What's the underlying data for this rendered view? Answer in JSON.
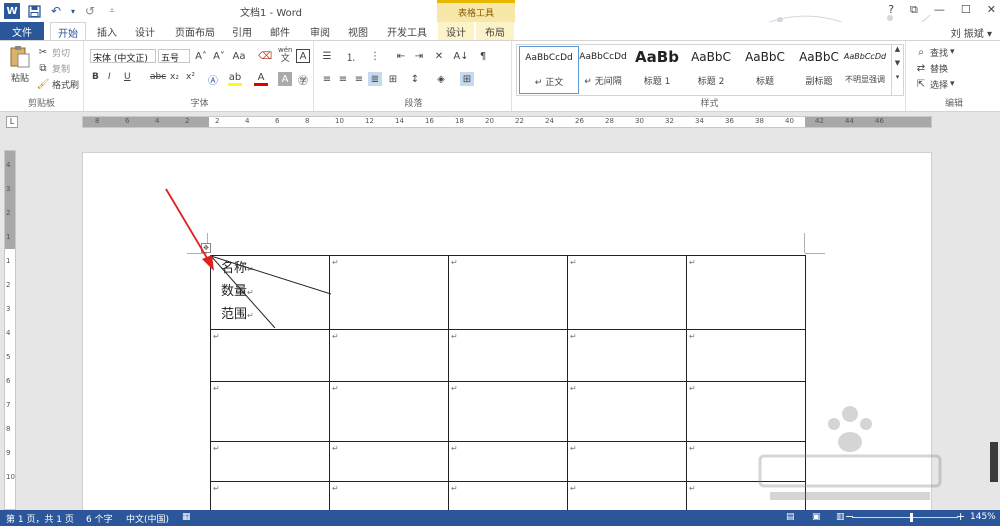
{
  "titlebar": {
    "app_icon": "W",
    "title": "文档1 - Word",
    "table_tools": "表格工具",
    "controls": [
      "?",
      "⧉",
      "—",
      "☐",
      "✕"
    ]
  },
  "tabs": {
    "file": "文件",
    "items": [
      "开始",
      "插入",
      "设计",
      "页面布局",
      "引用",
      "邮件",
      "审阅",
      "视图",
      "开发工具",
      "设计",
      "布局"
    ],
    "user": "刘 振斌 ▾"
  },
  "clipboard": {
    "paste": "粘贴",
    "cut": "剪切",
    "copy": "复制",
    "format_painter": "格式刷",
    "label": "剪贴板"
  },
  "font": {
    "font_name": "宋体 (中文正)",
    "font_size": "五号",
    "label": "字体",
    "buttons": [
      "B",
      "I",
      "U",
      "abc",
      "x₂",
      "x²"
    ],
    "pinyin": "wén"
  },
  "paragraph": {
    "label": "段落"
  },
  "styles": {
    "label": "样式",
    "items": [
      {
        "preview": "AaBbCcDd",
        "name": "↵ 正文"
      },
      {
        "preview": "AaBbCcDd",
        "name": "↵ 无间隔"
      },
      {
        "preview": "AaBb",
        "name": "标题 1"
      },
      {
        "preview": "AaBbC",
        "name": "标题 2"
      },
      {
        "preview": "AaBbC",
        "name": "标题"
      },
      {
        "preview": "AaBbC",
        "name": "副标题"
      },
      {
        "preview": "AaBbCcDd",
        "name": "不明显强调"
      }
    ]
  },
  "editing": {
    "find": "查找",
    "replace": "替换",
    "select": "选择",
    "label": "编辑"
  },
  "ruler": {
    "corner": "L",
    "h_ticks": [
      "8",
      "6",
      "4",
      "2",
      "2",
      "4",
      "6",
      "8",
      "10",
      "12",
      "14",
      "16",
      "18",
      "20",
      "22",
      "24",
      "26",
      "28",
      "30",
      "32",
      "34",
      "36",
      "38",
      "40",
      "42",
      "44",
      "46"
    ],
    "v_ticks": [
      "4",
      "3",
      "2",
      "1",
      "1",
      "2",
      "3",
      "4",
      "5",
      "6",
      "7",
      "8",
      "9",
      "10"
    ]
  },
  "document": {
    "move_handle": "✥",
    "header_cell": [
      "名称",
      "数量",
      "范围"
    ],
    "para_mark": "↵"
  },
  "status": {
    "page": "第 1 页，共 1 页",
    "words": "6 个字",
    "language": "中文(中国)",
    "zoom": "145%",
    "minus": "−",
    "plus": "+"
  }
}
